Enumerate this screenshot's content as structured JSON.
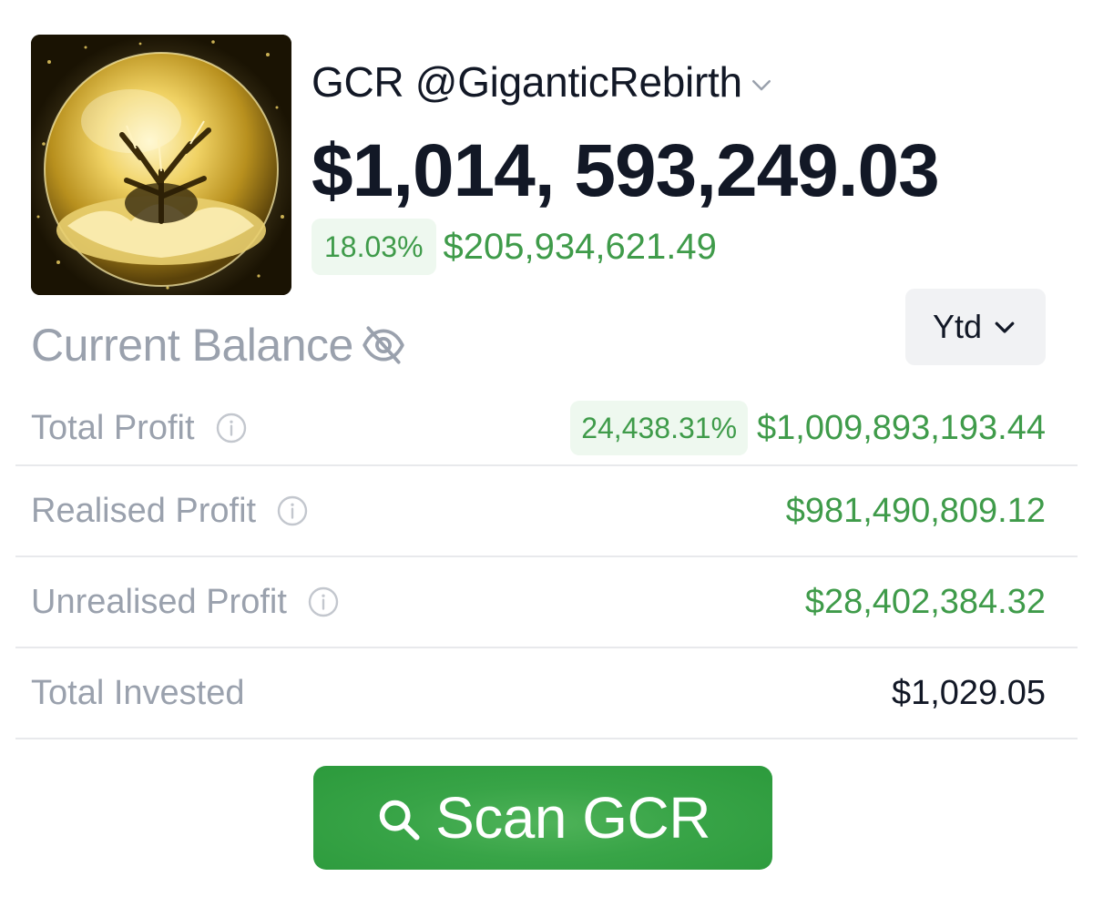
{
  "profile": {
    "handle": "GCR @GiganticRebirth",
    "avatar_icon": "golden-orb-avatar"
  },
  "balance": {
    "amount": "$1,014, 593,249.03",
    "change_percent": "18.03%",
    "change_amount": "$205,934,621.49",
    "label": "Current Balance",
    "visibility_icon": "eye-off-icon"
  },
  "period": {
    "selected": "Ytd"
  },
  "stats": [
    {
      "label": "Total Profit",
      "percent": "24,438.31%",
      "value": "$1,009,893,193.44",
      "info": true
    },
    {
      "label": "Realised Profit",
      "value": "$981,490,809.12",
      "info": true
    },
    {
      "label": "Unrealised Profit",
      "value": "$28,402,384.32",
      "info": true
    },
    {
      "label": "Total Invested",
      "value": "$1,029.05",
      "info": false
    }
  ],
  "actions": {
    "scan_label": "Scan GCR",
    "scan_icon": "search-icon"
  },
  "colors": {
    "positive": "#3f9b4a",
    "positive_bg": "#eef8ef",
    "muted_text": "#9aa1ad",
    "primary_text": "#121826",
    "button_green": "#38a447"
  }
}
